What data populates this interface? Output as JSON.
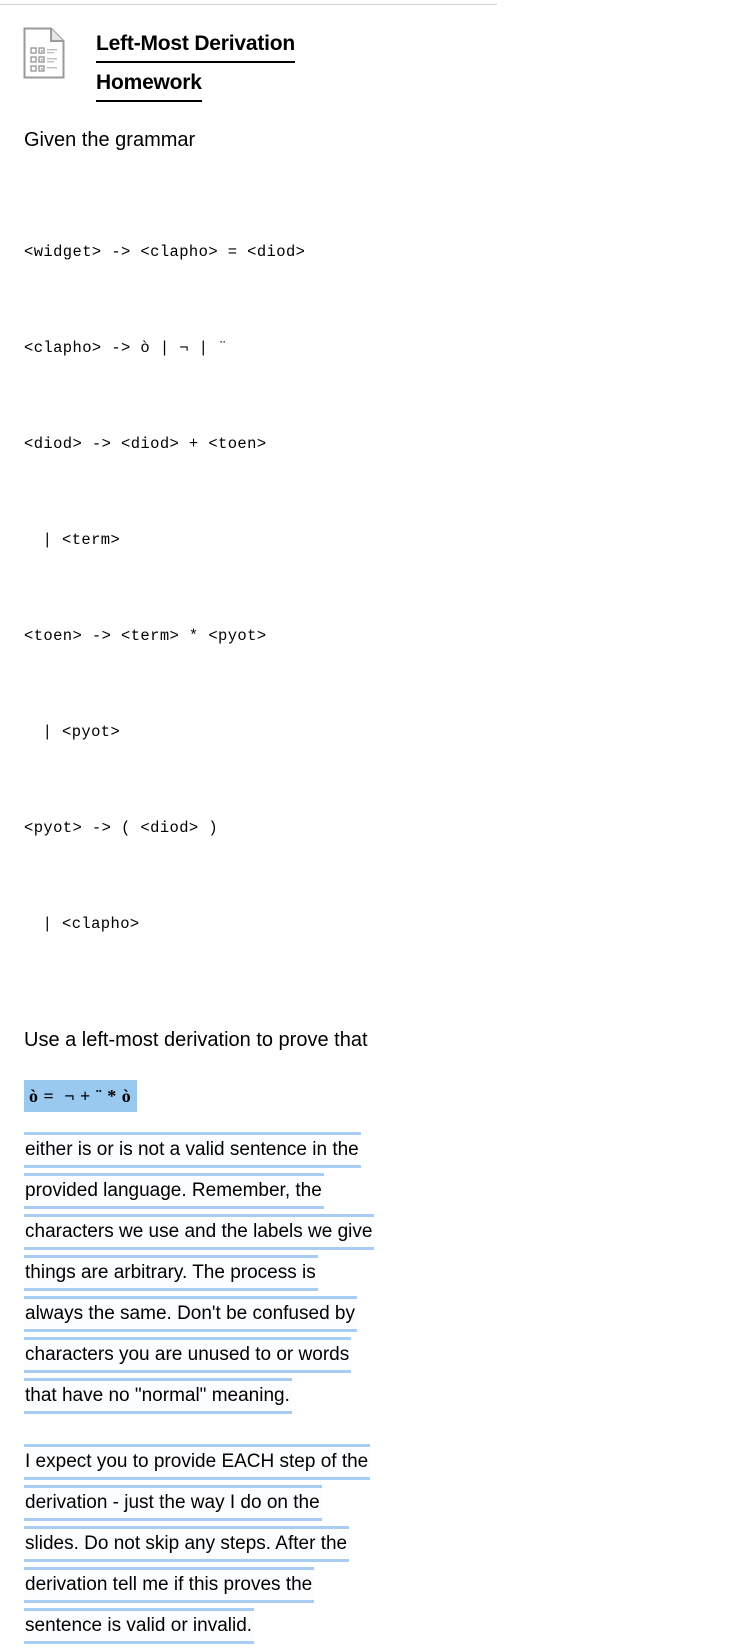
{
  "document": {
    "icon": "document-file-icon",
    "title_lines": [
      "Left-Most Derivation",
      "Homework"
    ],
    "intro": "Given the grammar",
    "grammar": [
      {
        "text": "<widget> -> <clapho> = <diod>",
        "indent": false
      },
      {
        "text": "<clapho> -> ò | ¬ | ¨",
        "indent": false
      },
      {
        "text": "<diod> -> <diod> + <toen>",
        "indent": false
      },
      {
        "text": "| <term>",
        "indent": true
      },
      {
        "text": "<toen> -> <term> * <pyot>",
        "indent": false
      },
      {
        "text": "| <pyot>",
        "indent": true
      },
      {
        "text": "<pyot> -> ( <diod> )",
        "indent": false
      },
      {
        "text": "| <clapho>",
        "indent": true
      }
    ],
    "prompt": "Use a left-most derivation to prove that",
    "formula": "ò =  ¬ + ¨ * ò",
    "paragraph_one": [
      "either is or is not a valid sentence in the",
      "provided language.  Remember, the",
      "characters we use and the labels we give",
      "things are arbitrary.  The process is",
      "always the same.  Don't be confused by",
      "characters you are unused to or words",
      "that have no \"normal\" meaning."
    ],
    "paragraph_two": [
      "I expect you to provide EACH step of the",
      "derivation - just the way I do on the",
      "slides.  Do not skip any steps.  After the",
      "derivation tell me if this proves the",
      "sentence is valid or invalid."
    ]
  },
  "colors": {
    "highlight_blue": "#9ac9f0",
    "selection_rule_blue": "#a9cdf2",
    "top_rule_grey": "#d4d4d4",
    "icon_grey": "#9a9a9a",
    "text_black": "#000000"
  }
}
